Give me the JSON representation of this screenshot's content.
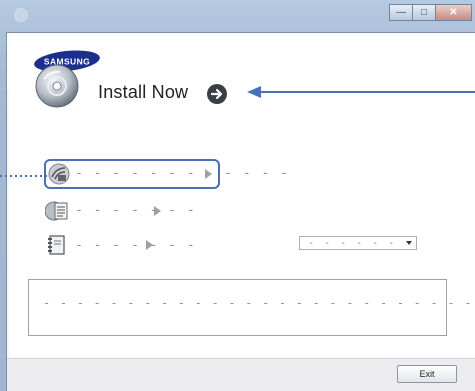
{
  "window": {
    "app_icon": "installer-icon",
    "controls": {
      "minimize_icon": "minimize-icon",
      "maximize_icon": "maximize-icon",
      "close_icon": "close-icon"
    }
  },
  "header": {
    "logo_text": "SAMSUNG",
    "brand_color": "#1c2f8c"
  },
  "install": {
    "icon": "disc-icon",
    "label": "Install Now",
    "go_icon": "arrow-right-circle-icon"
  },
  "options": [
    {
      "icon": "wireless-setting-icon",
      "label": "- - - - - - - - - - - -",
      "highlighted": true
    },
    {
      "icon": "document-list-icon",
      "label": "- - - - - - -",
      "highlighted": false
    },
    {
      "icon": "manual-book-icon",
      "label": "- - - - - - -",
      "highlighted": false
    }
  ],
  "language_select": {
    "value": "- - - - - - - -"
  },
  "description": {
    "text": "- - - - - - - - - - - - - - - - - - - - - - - - - - - - - - - -"
  },
  "footer": {
    "exit_label": "Exit"
  },
  "accent_colors": {
    "highlight_border": "#4a6fb5",
    "callout_arrow": "#4a6fb5"
  }
}
